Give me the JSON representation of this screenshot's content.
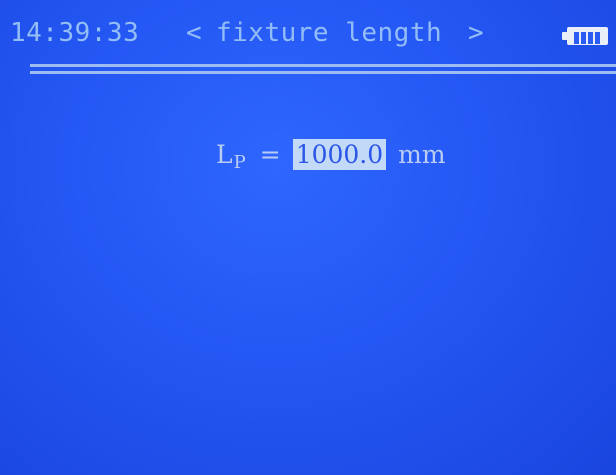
{
  "header": {
    "time": "14:39:33",
    "prev_symbol": "<",
    "title": "fixture length",
    "next_symbol": ">",
    "battery_icon": "battery-full-icon"
  },
  "field": {
    "label_main": "L",
    "label_sub": "P",
    "equals": "=",
    "value": "1000.0",
    "unit": "mm"
  },
  "colors": {
    "background": "#2457f3",
    "text": "#93bdf6",
    "highlight": "#c2d9f8"
  }
}
